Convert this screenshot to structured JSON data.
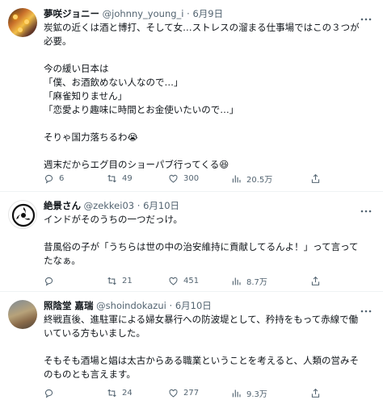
{
  "tweets": [
    {
      "name": "夢咲ジョニー",
      "handle": "@johnny_young_i",
      "date": "6月9日",
      "lines": [
        "炭鉱の近くは酒と博打、そして女…ストレスの溜まる仕事場ではこの３つが",
        "必要。",
        "",
        "今の緩い日本は",
        "「僕、お酒飲めない人なので…」",
        "「麻雀知りません」",
        "「恋愛より趣味に時間とお金使いたいので…」",
        "",
        "そりゃ国力落ちるわ😭",
        "",
        "週末だからエグ目のショーパブ行ってくる😆"
      ],
      "stats": {
        "replies": "6",
        "retweets": "49",
        "likes": "300",
        "views": "20.5万"
      }
    },
    {
      "name": "絶景さん",
      "handle": "@zekkei03",
      "date": "6月10日",
      "lines": [
        "インドがそのうちの一つだっけ。",
        "",
        "昔風俗の子が「うちらは世の中の治安維持に貢献してるんよ！」って言って",
        "たなぁ。"
      ],
      "stats": {
        "replies": "",
        "retweets": "21",
        "likes": "451",
        "views": "8.7万"
      }
    },
    {
      "name": "照陰堂 嘉瑞",
      "handle": "@shoindokazui",
      "date": "6月10日",
      "lines": [
        "終戦直後、進駐軍による婦女暴行への防波堤として、矜持をもって赤線で働",
        "いている方もいました。",
        "",
        "そもそも酒場と娼は太古からある職業ということを考えると、人類の営みそ",
        "のものとも言えます。"
      ],
      "stats": {
        "replies": "",
        "retweets": "24",
        "likes": "277",
        "views": "9.3万"
      }
    }
  ],
  "icons": [
    "reply-icon",
    "retweet-icon",
    "like-icon",
    "views-icon",
    "share-icon"
  ],
  "colors": {
    "text": "#0f1419",
    "muted": "#536471",
    "divider": "#eff3f4"
  }
}
